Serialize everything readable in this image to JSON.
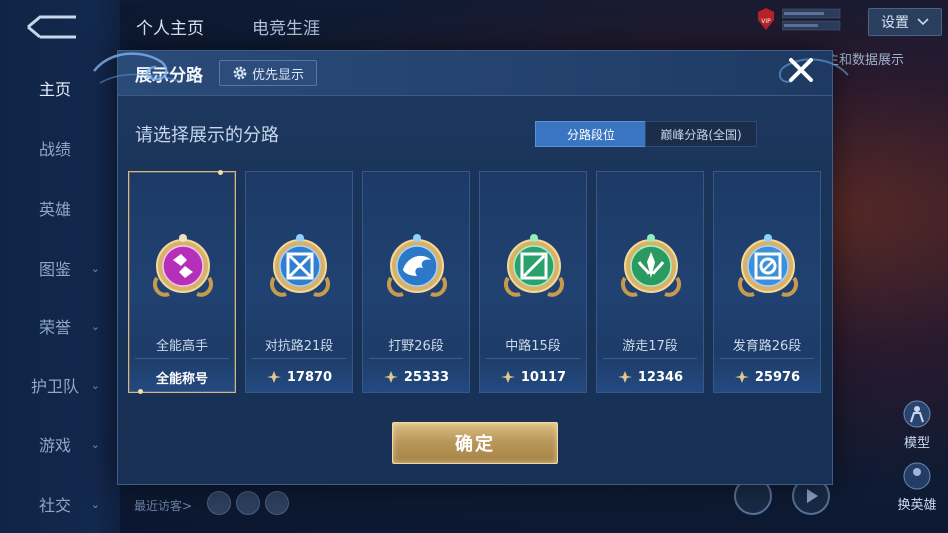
{
  "nav": {
    "tabs": [
      {
        "label": "个人主页",
        "active": true
      },
      {
        "label": "电竞生涯",
        "active": false
      }
    ],
    "settings_label": "设置",
    "vip_label": "VIP"
  },
  "sidebar": {
    "items": [
      {
        "label": "主页",
        "active": true,
        "has_chevron": false
      },
      {
        "label": "战绩",
        "active": false,
        "has_chevron": false
      },
      {
        "label": "英雄",
        "active": false,
        "has_chevron": false
      },
      {
        "label": "图鉴",
        "active": false,
        "has_chevron": true
      },
      {
        "label": "荣誉",
        "active": false,
        "has_chevron": true
      },
      {
        "label": "护卫队",
        "active": false,
        "has_chevron": true
      },
      {
        "label": "游戏",
        "active": false,
        "has_chevron": true
      },
      {
        "label": "社交",
        "active": false,
        "has_chevron": true
      }
    ]
  },
  "background": {
    "right_header_text": "主和数据展示",
    "model_label": "模型",
    "change_hero_label": "换英雄",
    "visitors_label": "最近访客>"
  },
  "dialog": {
    "title": "展示分路",
    "priority_button": "优先显示",
    "prompt": "请选择展示的分路",
    "segments": [
      {
        "label": "分路段位",
        "active": true
      },
      {
        "label": "巅峰分路(全国)",
        "active": false
      }
    ],
    "cards": [
      {
        "role": "全能高手",
        "title": "全能称号",
        "score": null,
        "emblem": "all-round-emblem",
        "selected": true
      },
      {
        "role": "对抗路21段",
        "title": null,
        "score": "17870",
        "emblem": "clash-lane-emblem",
        "selected": false
      },
      {
        "role": "打野26段",
        "title": null,
        "score": "25333",
        "emblem": "jungle-emblem",
        "selected": false
      },
      {
        "role": "中路15段",
        "title": null,
        "score": "10117",
        "emblem": "mid-lane-emblem",
        "selected": false
      },
      {
        "role": "游走17段",
        "title": null,
        "score": "12346",
        "emblem": "roam-emblem",
        "selected": false
      },
      {
        "role": "发育路26段",
        "title": null,
        "score": "25976",
        "emblem": "farm-lane-emblem",
        "selected": false
      }
    ],
    "confirm_label": "确定"
  },
  "colors": {
    "accent_blue": "#3a75c2",
    "gold": "#d9bd83",
    "selected_border": "#d8b680",
    "all_round_gem": "#b52fb8",
    "clash_gem": "#2f7fd0",
    "jungle_gem": "#2d79c9",
    "mid_gem": "#2aa06a",
    "roam_gem": "#2b9a62",
    "farm_gem": "#3c8fd8"
  }
}
